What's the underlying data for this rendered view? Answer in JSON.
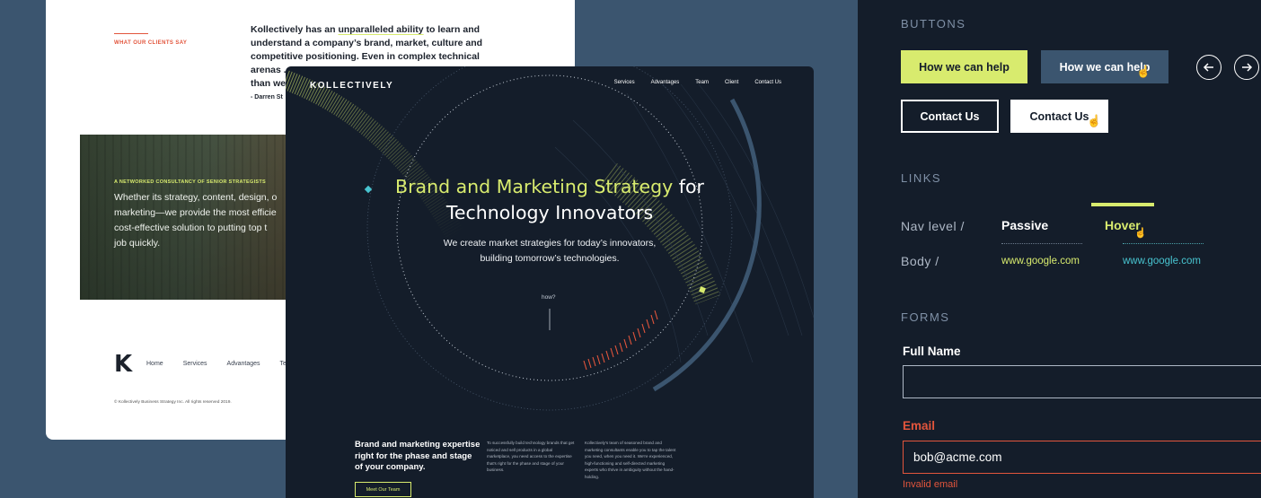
{
  "white_card": {
    "eyebrow": "WHAT OUR CLIENTS SAY",
    "quote_lines": [
      "Kollectively has an unparalleled ability to learn and",
      "understand a company’s brand, market, culture and",
      "competitive positioning. Even in complex technical",
      "arenas ...",
      "than we"
    ],
    "quote_underline": "unparalleled ability",
    "author": "- Darren St",
    "tag": "A NETWORKED CONSULTANCY OF SENIOR STRATEGISTS",
    "body_lines": [
      "Whether its strategy, content, design, o",
      "marketing—we provide the most efficie",
      "cost-effective solution to putting top t",
      "job quickly."
    ],
    "logo": "K",
    "nav": [
      "Home",
      "Services",
      "Advantages",
      "Te"
    ],
    "copyright": "© Kollectively Business Strategy Inc. All rights reserved 2019."
  },
  "dark_card": {
    "logo": "KOLLECTIVELY",
    "nav": [
      "Services",
      "Advantages",
      "Team",
      "Client",
      "Contact Us"
    ],
    "headline_highlight": "Brand and Marketing Strategy",
    "headline_rest": " for",
    "headline_line2": "Technology Innovators",
    "sub_line1": "We create market strategies for today’s innovators,",
    "sub_line2": "building tomorrow’s technologies.",
    "how": "how?",
    "feature_title": "Brand and marketing expertise right for the phase and stage of your company.",
    "feature_col2": "To successfully build technology brands that get noticed and sell products in a global marketplace, you need access to the expertise that's right for the phase and stage of your business.",
    "feature_col3": "Kollectively's team of seasoned brand and marketing consultants enable you to tap the talent you need, when you need it. We're experienced, high-functioning and self-directed marketing experts who thrive in ambiguity without the hand-holding.",
    "cta": "Meet Our Team"
  },
  "styleguide": {
    "buttons_heading": "BUTTONS",
    "btn_primary": "How we can help",
    "btn_primary_hover": "How we can help",
    "btn_outline": "Contact Us",
    "btn_outline_hover": "Contact Us",
    "prev_icon": "arrow-left-icon",
    "next_icon": "arrow-right-icon",
    "links_heading": "LINKS",
    "nav_label": "Nav level /",
    "nav_passive": "Passive",
    "nav_hover": "Hover",
    "body_label": "Body /",
    "link_passive": "www.google.com",
    "link_hover": "www.google.com",
    "forms_heading": "FORMS",
    "fullname_label": "Full Name",
    "fullname_value": "",
    "email_label": "Email",
    "email_value": "bob@acme.com",
    "email_error": "Invalid email"
  },
  "colors": {
    "background": "#3b556f",
    "navy": "#141d2a",
    "lime": "#d8eb6e",
    "error": "#e2553c",
    "teal": "#48c4d0"
  }
}
